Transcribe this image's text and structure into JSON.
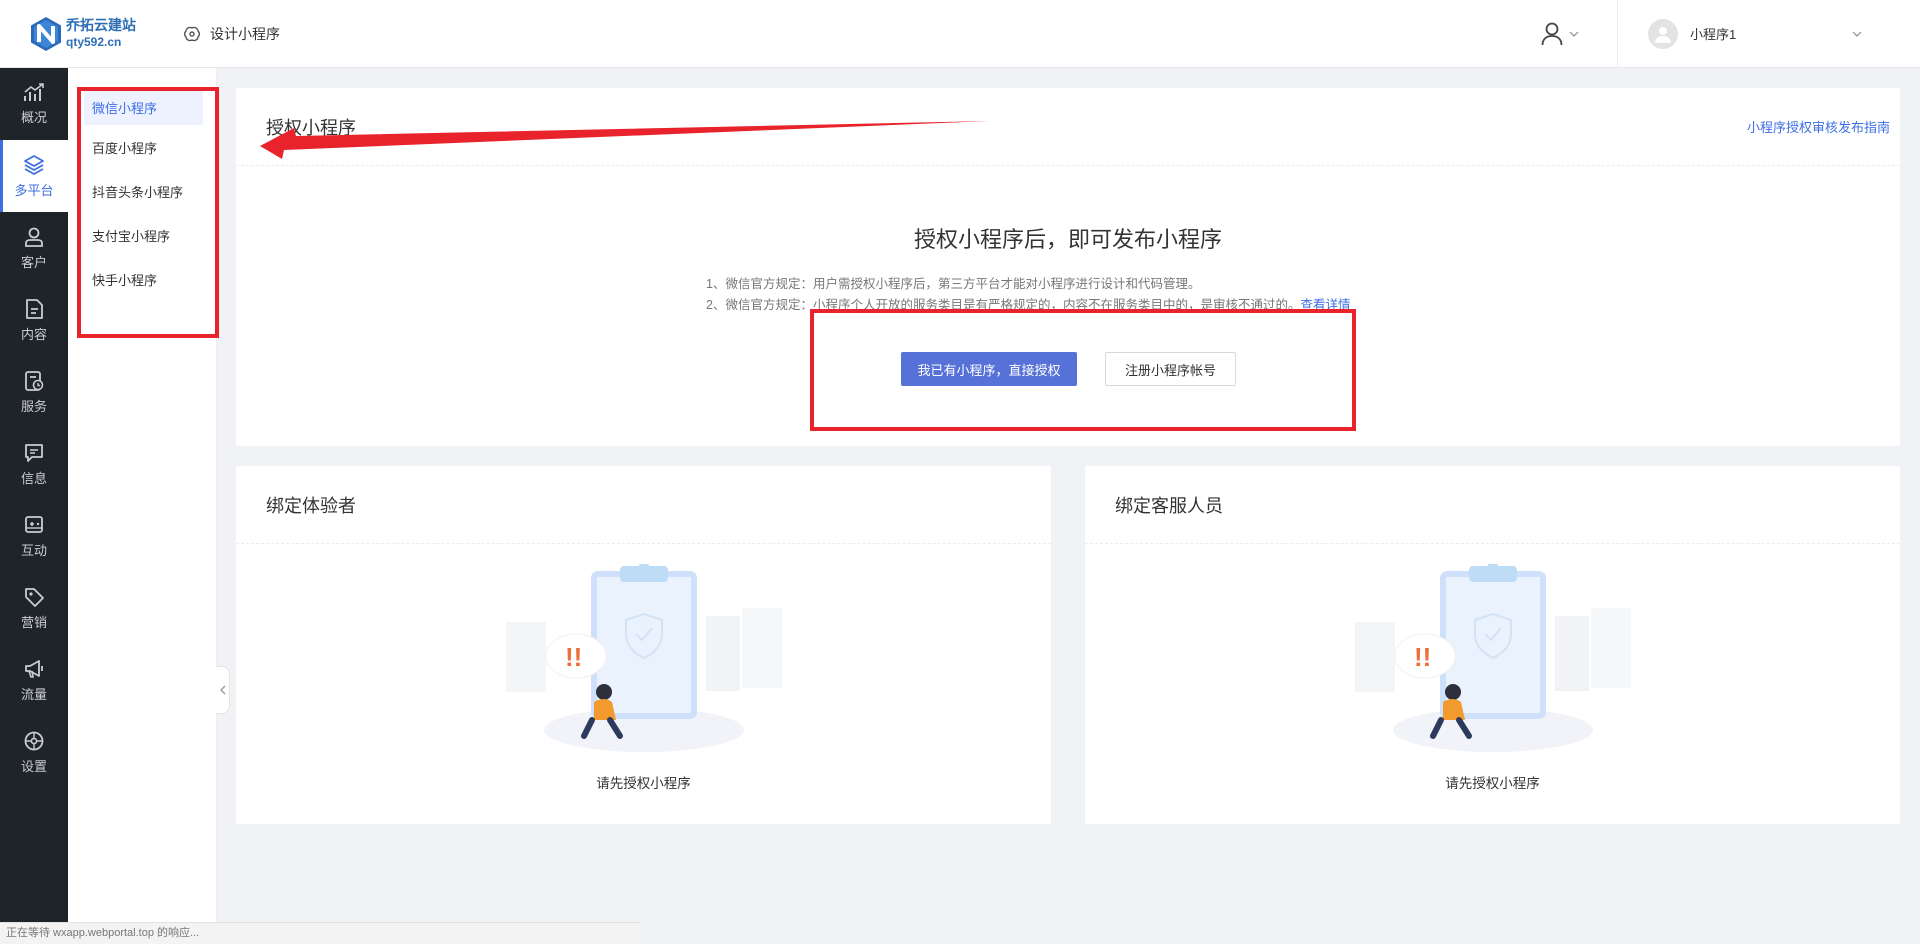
{
  "header": {
    "logo_name": "乔拓云建站",
    "logo_domain": "qty592.cn",
    "design_link": "设计小程序",
    "account_name": "小程序1"
  },
  "side_nav": [
    {
      "label": "概况",
      "icon": "chart-trend-icon"
    },
    {
      "label": "多平台",
      "icon": "layers-icon",
      "active": true
    },
    {
      "label": "客户",
      "icon": "person-icon"
    },
    {
      "label": "内容",
      "icon": "document-icon"
    },
    {
      "label": "服务",
      "icon": "service-icon"
    },
    {
      "label": "信息",
      "icon": "message-icon"
    },
    {
      "label": "互动",
      "icon": "gamepad-icon"
    },
    {
      "label": "营销",
      "icon": "tag-icon"
    },
    {
      "label": "流量",
      "icon": "megaphone-icon"
    },
    {
      "label": "设置",
      "icon": "settings-icon"
    }
  ],
  "sub_menu": [
    {
      "label": "微信小程序",
      "active": true
    },
    {
      "label": "百度小程序"
    },
    {
      "label": "抖音头条小程序"
    },
    {
      "label": "支付宝小程序"
    },
    {
      "label": "快手小程序"
    }
  ],
  "auth_card": {
    "title": "授权小程序",
    "guide_link": "小程序授权审核发布指南",
    "main_title": "授权小程序后，即可发布小程序",
    "rule1": "1、微信官方规定：用户需授权小程序后，第三方平台才能对小程序进行设计和代码管理。",
    "rule2": "2、微信官方规定：小程序个人开放的服务类目是有严格规定的，内容不在服务类目中的，是审核不通过的。",
    "rule2_link": "查看详情",
    "primary_button": "我已有小程序，直接授权",
    "secondary_button": "注册小程序帐号"
  },
  "tester_card": {
    "title": "绑定体验者",
    "empty_text": "请先授权小程序"
  },
  "service_card": {
    "title": "绑定客服人员",
    "empty_text": "请先授权小程序"
  },
  "status_bar": "正在等待 wxapp.webportal.top 的响应...",
  "colors": {
    "accent": "#3d6ee4",
    "primary_button": "#5671d8",
    "sidebar_bg": "#1f2428",
    "annotation_red": "#e8232b"
  }
}
